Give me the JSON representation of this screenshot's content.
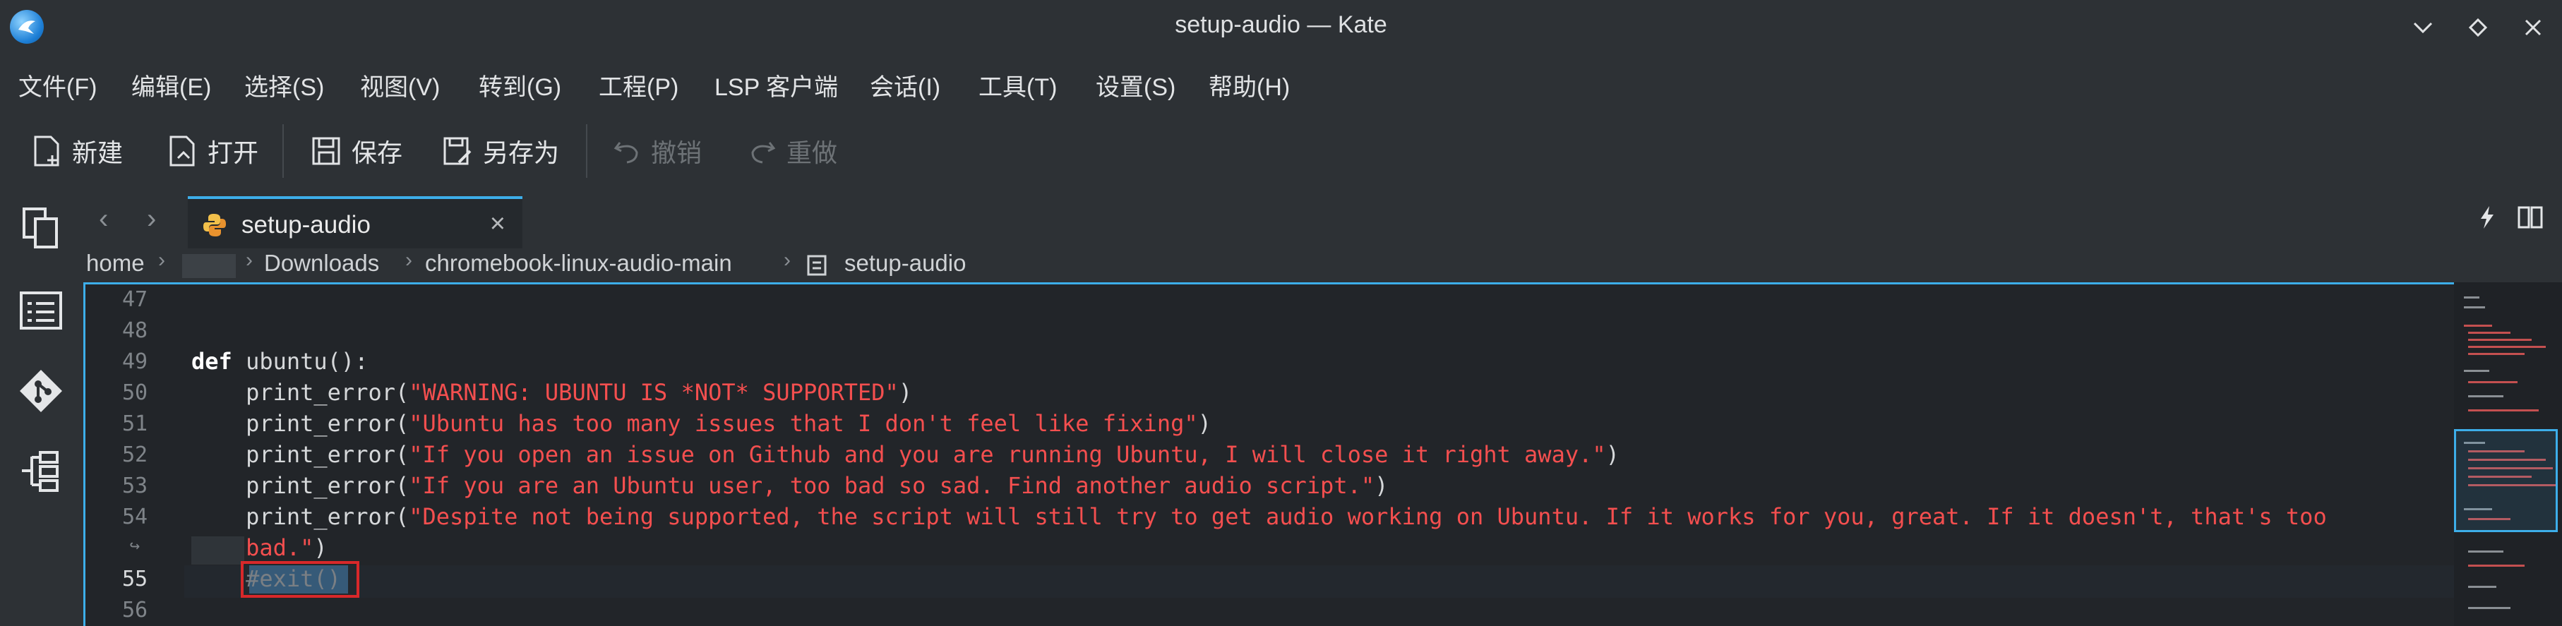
{
  "window": {
    "title": "setup-audio — Kate"
  },
  "menubar": [
    "文件(F)",
    "编辑(E)",
    "选择(S)",
    "视图(V)",
    "转到(G)",
    "工程(P)",
    "LSP 客户端",
    "会话(I)",
    "工具(T)",
    "设置(S)",
    "帮助(H)"
  ],
  "toolbar": {
    "new": "新建",
    "open": "打开",
    "save": "保存",
    "save_as": "另存为",
    "undo": "撤销",
    "redo": "重做"
  },
  "tab": {
    "label": "setup-audio"
  },
  "breadcrumb": [
    "home",
    "Downloads",
    "chromebook-linux-audio-main",
    "setup-audio"
  ],
  "editor": {
    "lines": [
      {
        "num": "47",
        "text": ""
      },
      {
        "num": "48",
        "text": ""
      },
      {
        "num": "49",
        "kw": "def",
        "text": " ubuntu():"
      },
      {
        "num": "50",
        "pre": "    print_error(",
        "str": "\"WARNING: UBUNTU IS *NOT* SUPPORTED\"",
        "post": ")"
      },
      {
        "num": "51",
        "pre": "    print_error(",
        "str": "\"Ubuntu has too many issues that I don't feel like fixing\"",
        "post": ")"
      },
      {
        "num": "52",
        "pre": "    print_error(",
        "str": "\"If you open an issue on Github and you are running Ubuntu, I will close it right away.\"",
        "post": ")"
      },
      {
        "num": "53",
        "pre": "    print_error(",
        "str": "\"If you are an Ubuntu user, too bad so sad. Find another audio script.\"",
        "post": ")"
      },
      {
        "num": "54",
        "pre": "    print_error(",
        "str": "\"Despite not being supported, the script will still try to get audio working on Ubuntu. If it works for you, great. If it doesn't, that's too",
        "post": ""
      },
      {
        "num": "↪",
        "pre": "    ",
        "str": "bad.\"",
        "post": ")"
      },
      {
        "num": "55",
        "pre": "    ",
        "cmt": "#exit()"
      },
      {
        "num": "56",
        "text": ""
      }
    ]
  }
}
